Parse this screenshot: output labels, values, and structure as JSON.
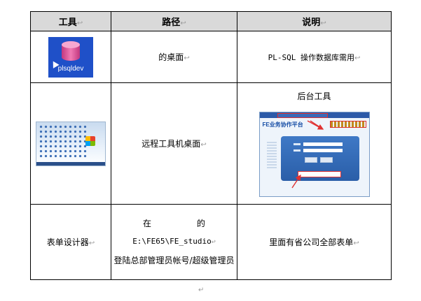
{
  "table": {
    "headers": [
      "工具",
      "路径",
      "说明"
    ],
    "rows": [
      {
        "tool_icon_label": "plsqldev",
        "path": "的桌面",
        "desc": "PL-SQL 操作数据库需用"
      },
      {
        "path": "远程工具机桌面",
        "desc_title": "后台工具",
        "screenshot_brand": "FE业务协作平台"
      },
      {
        "tool": "表单设计器",
        "path_prefix": "在",
        "path_suffix": "的",
        "path_dir": "E:\\FE65\\FE_studio",
        "path_login": "登陆总部管理员帐号/超级管理员",
        "desc": "里面有省公司全部表单"
      }
    ]
  },
  "marks": {
    "cell_end": "↩",
    "paragraph_end": "↵"
  },
  "colors": {
    "header_bg": "#d9d9d9",
    "icon_bg": "#1f50c8",
    "highlight_red": "#e03131"
  }
}
